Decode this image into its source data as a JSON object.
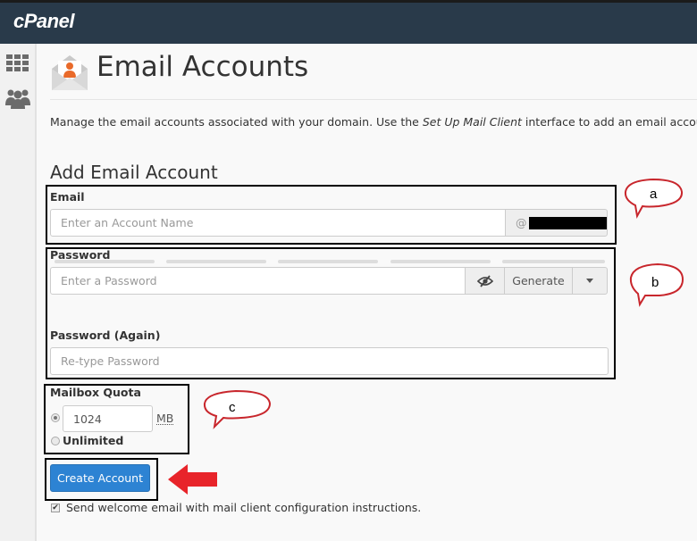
{
  "header": {
    "logo": "cPanel"
  },
  "sidebar": {
    "items": [
      {
        "icon": "grid-icon",
        "label": "Home"
      },
      {
        "icon": "users-icon",
        "label": "User Manager"
      }
    ]
  },
  "page": {
    "title": "Email Accounts",
    "description_before": "Manage the email accounts associated with your domain. Use the ",
    "description_link": "Set Up Mail Client",
    "description_after": " interface to add an email account to you"
  },
  "form": {
    "section_title": "Add Email Account",
    "email": {
      "label": "Email",
      "placeholder": "Enter an Account Name",
      "domain_prefix": "@",
      "domain_value": "[redacted]"
    },
    "password": {
      "label": "Password",
      "placeholder": "Enter a Password",
      "toggle_icon": "eye-slash-icon",
      "generate_label": "Generate",
      "dropdown_icon": "caret-down-icon",
      "strength_segments": 5,
      "strength_level": 0
    },
    "password_again": {
      "label": "Password (Again)",
      "placeholder": "Re-type Password"
    },
    "quota": {
      "label": "Mailbox Quota",
      "value": "1024",
      "unit": "MB",
      "selected": "limited",
      "unlimited_label": "Unlimited"
    },
    "submit_label": "Create Account",
    "welcome_email": {
      "checked": true,
      "label": "Send welcome email with mail client configuration instructions."
    }
  },
  "annotations": {
    "a": "a",
    "b": "b",
    "c": "c",
    "arrow_color": "#e8242a",
    "bubble_color": "#c8262c"
  }
}
